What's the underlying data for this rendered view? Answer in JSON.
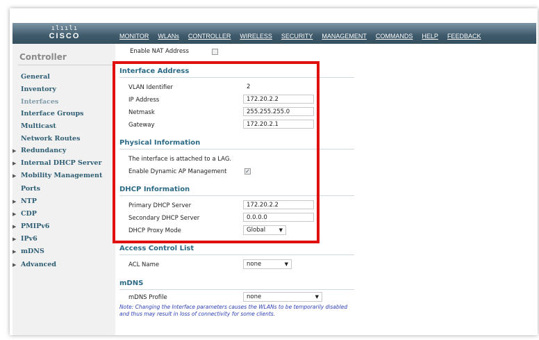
{
  "brand": {
    "bars": "ılıılı",
    "name": "CISCO"
  },
  "nav": [
    "MONITOR",
    "WLANs",
    "CONTROLLER",
    "WIRELESS",
    "SECURITY",
    "MANAGEMENT",
    "COMMANDS",
    "HELP",
    "FEEDBACK"
  ],
  "sidebar": {
    "title": "Controller",
    "items": [
      {
        "label": "General",
        "arrow": false
      },
      {
        "label": "Inventory",
        "arrow": false
      },
      {
        "label": "Interfaces",
        "arrow": false
      },
      {
        "label": "Interface Groups",
        "arrow": false
      },
      {
        "label": "Multicast",
        "arrow": false
      },
      {
        "label": "Network Routes",
        "arrow": false
      },
      {
        "label": "Redundancy",
        "arrow": true
      },
      {
        "label": "Internal DHCP Server",
        "arrow": true
      },
      {
        "label": "Mobility Management",
        "arrow": true
      },
      {
        "label": "Ports",
        "arrow": false
      },
      {
        "label": "NTP",
        "arrow": true
      },
      {
        "label": "CDP",
        "arrow": true
      },
      {
        "label": "PMIPv6",
        "arrow": true
      },
      {
        "label": "IPv6",
        "arrow": true
      },
      {
        "label": "mDNS",
        "arrow": true
      },
      {
        "label": "Advanced",
        "arrow": true
      }
    ]
  },
  "main": {
    "nat_label": "Enable NAT Address",
    "interface_address": {
      "title": "Interface Address",
      "vlan_label": "VLAN Identifier",
      "vlan_value": "2",
      "ip_label": "IP Address",
      "ip_value": "172.20.2.2",
      "netmask_label": "Netmask",
      "netmask_value": "255.255.255.0",
      "gateway_label": "Gateway",
      "gateway_value": "172.20.2.1"
    },
    "physical": {
      "title": "Physical Information",
      "lag_text": "The interface is attached to a LAG.",
      "dyn_ap_label": "Enable Dynamic AP Management"
    },
    "dhcp": {
      "title": "DHCP Information",
      "primary_label": "Primary DHCP Server",
      "primary_value": "172.20.2.2",
      "secondary_label": "Secondary DHCP Server",
      "secondary_value": "0.0.0.0",
      "proxy_label": "DHCP Proxy Mode",
      "proxy_value": "Global"
    },
    "acl": {
      "title": "Access Control List",
      "acl_label": "ACL Name",
      "acl_value": "none"
    },
    "mdns": {
      "title": "mDNS",
      "profile_label": "mDNS Profile",
      "profile_value": "none"
    },
    "note": "Note: Changing the Interface parameters causes the WLANs to be temporarily disabled and thus may result in loss of connectivity for some clients."
  }
}
